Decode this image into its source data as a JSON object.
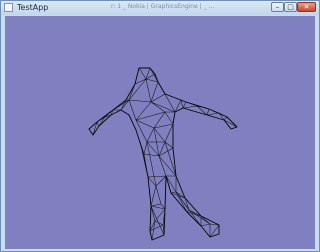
{
  "window": {
    "title": "TestApp",
    "behind_text": "r: 1  _ Nokia | GraphicsEngine | _ ...",
    "controls": {
      "minimize": "–",
      "maximize": "□",
      "close": "✕"
    }
  },
  "viewport": {
    "background": "#8080c0",
    "subject": "wireframe body mesh"
  }
}
